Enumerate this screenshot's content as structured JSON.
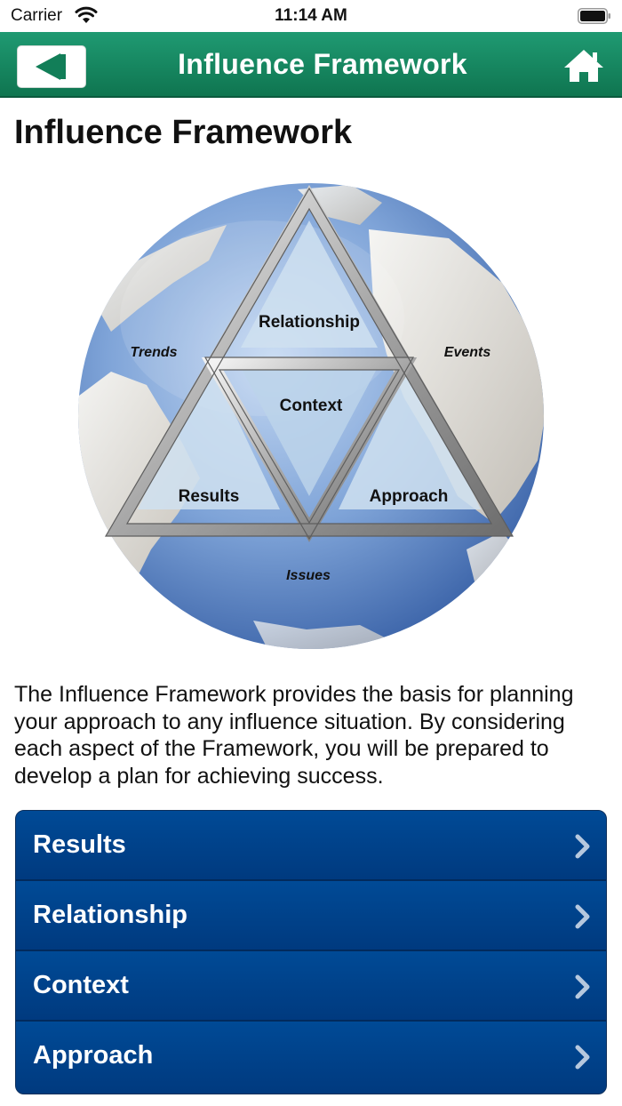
{
  "status_bar": {
    "carrier": "Carrier",
    "time": "11:14 AM"
  },
  "nav": {
    "title": "Influence Framework",
    "back_icon": "back-arrow-icon",
    "home_icon": "home-icon",
    "bar_color": "#178a63"
  },
  "page": {
    "heading": "Influence Framework",
    "description": "The Influence Framework provides the basis for planning your approach to any influence situation. By considering each aspect of the Framework, you will be prepared to develop a plan for achieving success."
  },
  "diagram": {
    "inner_labels": {
      "top": "Relationship",
      "center": "Context",
      "left": "Results",
      "right": "Approach"
    },
    "outer_labels": {
      "left": "Trends",
      "right": "Events",
      "bottom": "Issues"
    }
  },
  "menu": {
    "accent": "#003d80",
    "items": [
      {
        "label": "Results"
      },
      {
        "label": "Relationship"
      },
      {
        "label": "Context"
      },
      {
        "label": "Approach"
      }
    ]
  }
}
